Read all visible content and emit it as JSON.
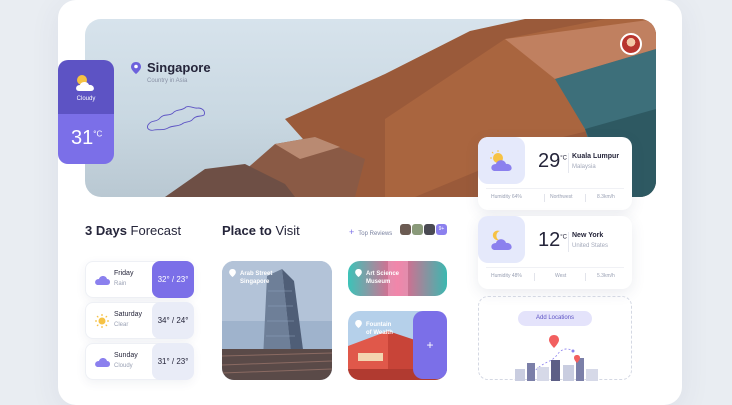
{
  "hero": {
    "city": "Singapore",
    "country": "Country in Asia"
  },
  "current": {
    "condition": "Cloudy",
    "temp": "31",
    "unit": "°C",
    "icon": "sun-cloud-icon"
  },
  "forecast": {
    "title_bold": "3 Days",
    "title_rest": " Forecast",
    "days": [
      {
        "day": "Friday",
        "condition": "Rain",
        "temp": "32° / 23°",
        "icon": "cloud-icon"
      },
      {
        "day": "Saturday",
        "condition": "Clear",
        "temp": "34° / 24°",
        "icon": "sun-icon"
      },
      {
        "day": "Sunday",
        "condition": "Cloudy",
        "temp": "31° / 23°",
        "icon": "cloud-icon"
      }
    ]
  },
  "places": {
    "title_bold": "Place to",
    "title_rest": " Visit",
    "reviews_label": "Top Reviews",
    "reviews_count": "9+",
    "items": [
      {
        "name": "Arab Street\nSingapore"
      },
      {
        "name": "Art Science\nMuseum"
      },
      {
        "name": "Fountain\nof Wealth"
      }
    ],
    "add_label": "+"
  },
  "cities": [
    {
      "temp": "29",
      "unit": "°C",
      "name": "Kuala Lumpur",
      "country": "Malaysia",
      "humidity": "Humidity 64%",
      "wind_dir": "Northwest",
      "wind_speed": "8.3km/h",
      "icon": "sun-cloud-icon"
    },
    {
      "temp": "12",
      "unit": "°C",
      "name": "New York",
      "country": "United States",
      "humidity": "Humidity 48%",
      "wind_dir": "West",
      "wind_speed": "5.3km/h",
      "icon": "moon-cloud-icon"
    }
  ],
  "add_locations_label": "Add Locations",
  "colors": {
    "accent": "#7b6fe8",
    "accent_dark": "#5d53c4",
    "text": "#25253a",
    "muted": "#9aa1b4"
  }
}
